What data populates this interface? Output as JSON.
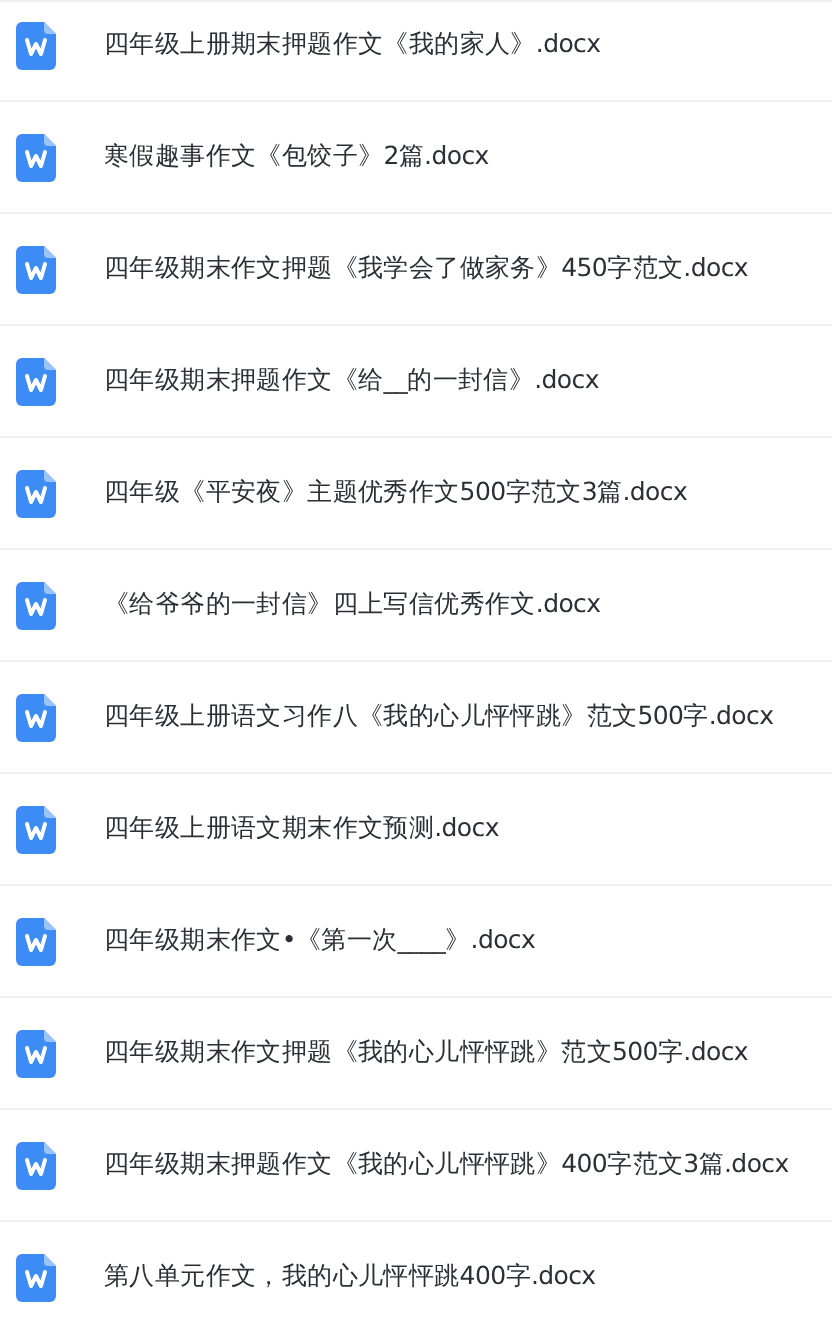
{
  "files": [
    {
      "name": "四年级上册期末押题作文《我的家人》.docx"
    },
    {
      "name": "寒假趣事作文《包饺子》2篇.docx"
    },
    {
      "name": "四年级期末作文押题《我学会了做家务》450字范文.docx"
    },
    {
      "name": "四年级期末押题作文《给__的一封信》.docx"
    },
    {
      "name": "四年级《平安夜》主题优秀作文500字范文3篇.docx"
    },
    {
      "name": "《给爷爷的一封信》四上写信优秀作文.docx"
    },
    {
      "name": "四年级上册语文习作八《我的心儿怦怦跳》范文500字.docx"
    },
    {
      "name": "四年级上册语文期末作文预测.docx"
    },
    {
      "name": "四年级期末作文•《第一次____》.docx"
    },
    {
      "name": "四年级期末作文押题《我的心儿怦怦跳》范文500字.docx"
    },
    {
      "name": "四年级期末押题作文《我的心儿怦怦跳》400字范文3篇.docx"
    },
    {
      "name": "第八单元作文，我的心儿怦怦跳400字.docx"
    }
  ]
}
